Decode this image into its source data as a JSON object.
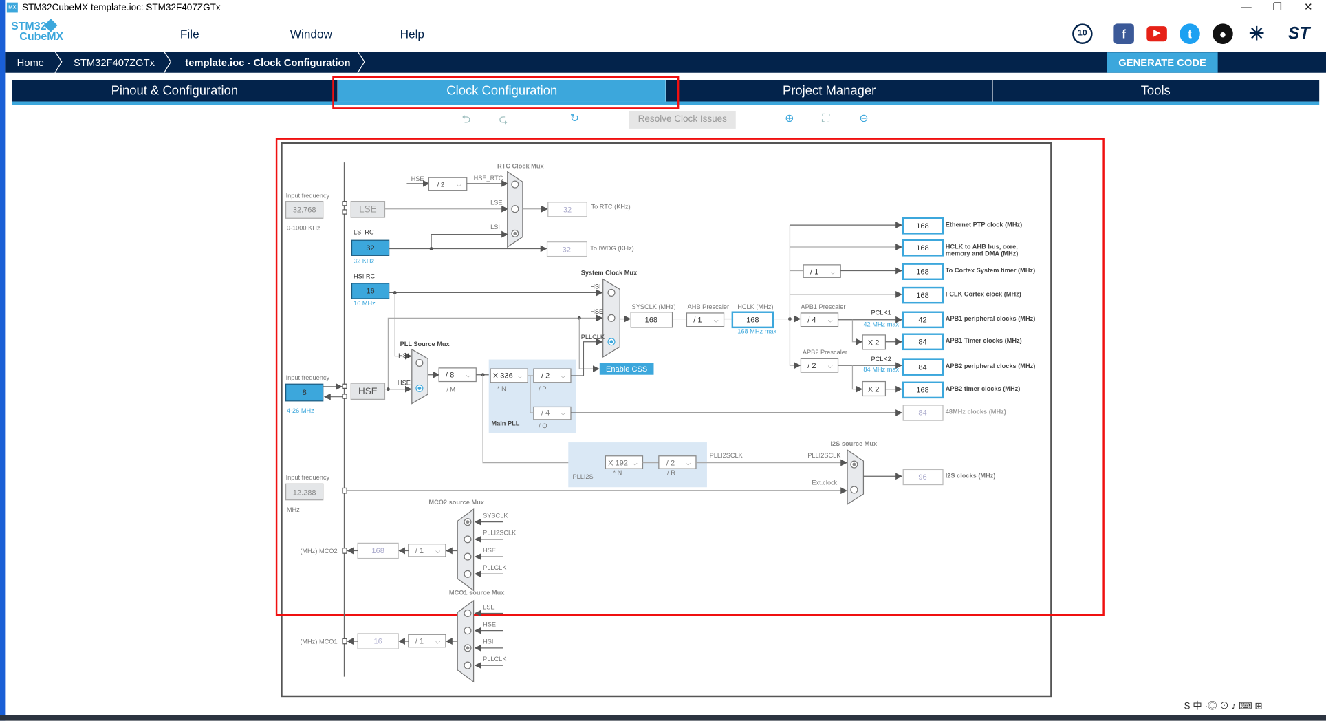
{
  "window": {
    "title": "STM32CubeMX template.ioc: STM32F407ZGTx",
    "app_icon": "MX",
    "minimize": "—",
    "restore": "❐",
    "close": "✕"
  },
  "logo": {
    "line1": "STM32",
    "line2": "CubeMX"
  },
  "menu": [
    "File",
    "Window",
    "Help"
  ],
  "social": [
    {
      "name": "anniversary-badge",
      "glyph": "10"
    },
    {
      "name": "facebook",
      "glyph": "f",
      "color": "#3b5998"
    },
    {
      "name": "youtube",
      "glyph": "▶",
      "color": "#e62117"
    },
    {
      "name": "twitter",
      "glyph": "t",
      "color": "#1da1f2"
    },
    {
      "name": "github",
      "glyph": "●",
      "color": "#111"
    },
    {
      "name": "network",
      "glyph": "✳",
      "color": "#03234b"
    },
    {
      "name": "st-logo",
      "glyph": "ST",
      "color": "#03234b"
    }
  ],
  "breadcrumb": [
    "Home",
    "STM32F407ZGTx",
    "template.ioc - Clock Configuration"
  ],
  "generate_code": "GENERATE CODE",
  "tabs": [
    {
      "label": "Pinout & Configuration"
    },
    {
      "label": "Clock Configuration",
      "active": true
    },
    {
      "label": "Project Manager"
    },
    {
      "label": "Tools"
    }
  ],
  "toolbar": {
    "undo": "⮌",
    "redo": "⮎",
    "reset": "↻",
    "resolve": "Resolve Clock Issues",
    "zoom_in": "⊕",
    "fit": "⛶",
    "zoom_out": "⊖"
  },
  "colors": {
    "accent": "#3ca7dc",
    "navy": "#03234b",
    "highlight": "#f01010"
  },
  "diagram": {
    "lse": {
      "input_label": "Input frequency",
      "input": "32.768",
      "range": "0-1000 KHz",
      "name": "LSE"
    },
    "lsi": {
      "label": "LSI RC",
      "value": "32",
      "unit": "32 KHz"
    },
    "hsi": {
      "label": "HSI RC",
      "value": "16",
      "unit": "16 MHz"
    },
    "hse": {
      "input_label": "Input frequency",
      "input": "8",
      "range": "4-26 MHz",
      "name": "HSE"
    },
    "rtc": {
      "mux_label": "RTC Clock Mux",
      "hse_label": "HSE",
      "div": "/ 2",
      "hse_rtc": "HSE_RTC",
      "lse_label": "LSE",
      "lsi_label": "LSI",
      "rtc_value": "32",
      "rtc_label": "To RTC (KHz)",
      "iwdg_value": "32",
      "iwdg_label": "To IWDG (KHz)"
    },
    "sysmux": {
      "label": "System Clock Mux",
      "hsi": "HSI",
      "hse": "HSE",
      "pllclk": "PLLCLK",
      "selected": "PLLCLK",
      "css": "Enable CSS"
    },
    "pllsrc": {
      "label": "PLL Source Mux",
      "hsi": "HSI",
      "hse": "HSE",
      "selected": "HSE"
    },
    "pll": {
      "m": "/ 8",
      "m_label": "/ M",
      "n": "X 336",
      "n_label": "* N",
      "p": "/ 2",
      "p_label": "/ P",
      "q": "/ 4",
      "q_label": "/ Q",
      "name": "Main PLL"
    },
    "sysclk": {
      "label": "SYSCLK (MHz)",
      "value": "168"
    },
    "ahb": {
      "label": "AHB Prescaler",
      "value": "/ 1"
    },
    "hclk": {
      "label": "HCLK (MHz)",
      "value": "168",
      "max": "168 MHz max"
    },
    "cortex_div": "/ 1",
    "apb1": {
      "label": "APB1 Prescaler",
      "value": "/ 4",
      "pclk": "PCLK1",
      "max": "42 MHz max",
      "mult": "X 2"
    },
    "apb2": {
      "label": "APB2 Prescaler",
      "value": "/ 2",
      "pclk": "PCLK2",
      "max": "84 MHz max",
      "mult": "X 2"
    },
    "outputs": [
      {
        "value": "168",
        "label": "Ethernet PTP clock (MHz)"
      },
      {
        "value": "168",
        "label": "HCLK to AHB bus, core,",
        "label2": "memory and DMA (MHz)"
      },
      {
        "value": "168",
        "label": "To Cortex System timer (MHz)"
      },
      {
        "value": "168",
        "label": "FCLK Cortex clock (MHz)"
      },
      {
        "value": "42",
        "label": "APB1 peripheral clocks (MHz)"
      },
      {
        "value": "84",
        "label": "APB1 Timer clocks (MHz)"
      },
      {
        "value": "84",
        "label": "APB2 peripheral clocks (MHz)"
      },
      {
        "value": "168",
        "label": "APB2 timer clocks (MHz)"
      },
      {
        "value": "84",
        "label": "48MHz clocks (MHz)"
      }
    ],
    "plli2s": {
      "n": "X 192",
      "n_label": "* N",
      "r": "/ 2",
      "r_label": "/ R",
      "name": "PLLI2S",
      "out": "PLLI2SCLK"
    },
    "i2s": {
      "mux_label": "I2S source Mux",
      "in1": "PLLI2SCLK",
      "in2": "Ext.clock",
      "value": "96",
      "label": "I2S clocks (MHz)",
      "input_label": "Input frequency",
      "input": "12.288",
      "unit": "MHz",
      "selected": "PLLI2SCLK"
    },
    "mco2": {
      "mux_label": "MCO2 source Mux",
      "inputs": [
        "SYSCLK",
        "PLLI2SCLK",
        "HSE",
        "PLLCLK"
      ],
      "selected": "SYSCLK",
      "div": "/ 1",
      "value": "168",
      "label": "(MHz) MCO2"
    },
    "mco1": {
      "mux_label": "MCO1 source Mux",
      "inputs": [
        "LSE",
        "HSE",
        "HSI",
        "PLLCLK"
      ],
      "selected": "HSI",
      "div": "/ 1",
      "value": "16",
      "label": "(MHz) MCO1"
    }
  },
  "tray": "S 中 ·◎ ⊙ ♪ ⌨ ⊞"
}
